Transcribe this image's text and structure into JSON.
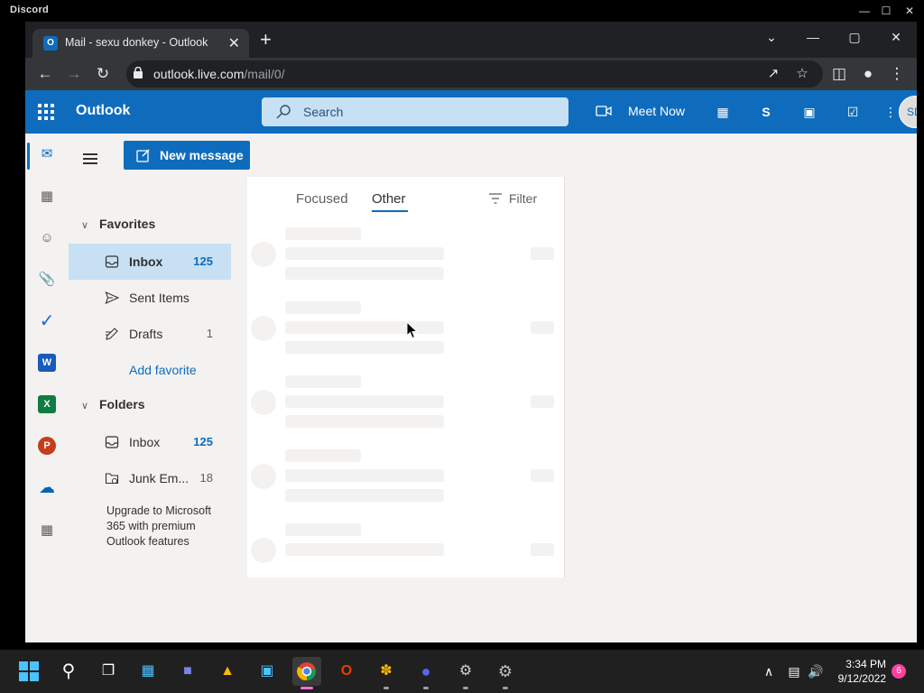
{
  "discord": {
    "title": "Discord"
  },
  "browser": {
    "tab_title": "Mail - sexu donkey - Outlook",
    "url_host": "outlook.live.com",
    "url_path": "/mail/0/"
  },
  "outlook": {
    "brand": "Outlook",
    "search_placeholder": "Search",
    "meet_now": "Meet Now",
    "avatar_initials": "SD",
    "new_message": "New message",
    "favorites": {
      "heading": "Favorites",
      "items": [
        {
          "label": "Inbox",
          "count": "125"
        },
        {
          "label": "Sent Items",
          "count": ""
        },
        {
          "label": "Drafts",
          "count": "1"
        }
      ],
      "add_favorite": "Add favorite"
    },
    "folders": {
      "heading": "Folders",
      "items": [
        {
          "label": "Inbox",
          "count": "125"
        },
        {
          "label": "Junk Em...",
          "count": "18"
        }
      ]
    },
    "upgrade_text": "Upgrade to Microsoft 365 with premium Outlook features",
    "pivots": {
      "focused": "Focused",
      "other": "Other",
      "active": "Other"
    },
    "filter": "Filter"
  },
  "taskbar": {
    "time": "3:34 PM",
    "date": "9/12/2022",
    "notification_count": "6"
  },
  "colors": {
    "outlook_blue": "#0f6cbd",
    "selected_folder": "#c7e0f4"
  }
}
